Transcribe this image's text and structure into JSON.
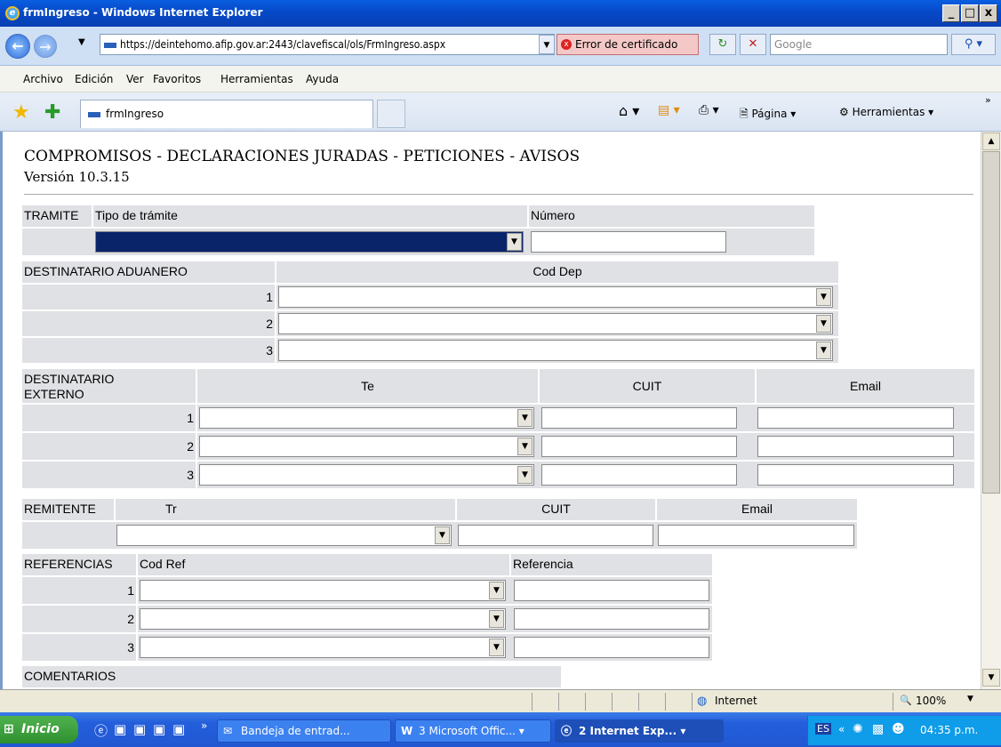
{
  "window": {
    "title": "frmIngreso - Windows Internet Explorer",
    "min": "_",
    "max": "□",
    "close": "x"
  },
  "address": {
    "url": "https://deintehomo.afip.gov.ar:2443/clavefiscal/ols/FrmIngreso.aspx",
    "cert_error": "Error de certificado",
    "search_placeholder": "Google"
  },
  "menu": [
    "Archivo",
    "Edición",
    "Ver",
    "Favoritos",
    "Herramientas",
    "Ayuda"
  ],
  "tab": {
    "label": "frmIngreso"
  },
  "commands": {
    "page": "Página",
    "tools": "Herramientas"
  },
  "page": {
    "title": "COMPROMISOS - DECLARACIONES JURADAS - PETICIONES - AVISOS",
    "version": "Versión 10.3.15",
    "tramite": {
      "section": "TRAMITE",
      "col_tipo": "Tipo de trámite",
      "col_numero": "Número"
    },
    "dest_aduanero": {
      "section": "DESTINATARIO ADUANERO",
      "col_coddep": "Cod Dep",
      "rows": [
        "1",
        "2",
        "3"
      ]
    },
    "dest_externo": {
      "section_l1": "DESTINATARIO",
      "section_l2": "EXTERNO",
      "col_te": "Te",
      "col_cuit": "CUIT",
      "col_email": "Email",
      "rows": [
        "1",
        "2",
        "3"
      ]
    },
    "remitente": {
      "section": "REMITENTE",
      "col_tr": "Tr",
      "col_cuit": "CUIT",
      "col_email": "Email"
    },
    "referencias": {
      "section": "REFERENCIAS",
      "col_codref": "Cod Ref",
      "col_ref": "Referencia",
      "rows": [
        "1",
        "2",
        "3"
      ]
    },
    "comentarios": {
      "section": "COMENTARIOS"
    }
  },
  "status": {
    "zone": "Internet",
    "zoom": "100%"
  },
  "taskbar": {
    "start": "Inicio",
    "buttons": [
      "Bandeja de entrad...",
      "3 Microsoft Offic...",
      "2 Internet Exp..."
    ],
    "lang": "ES",
    "clock": "04:35 p.m."
  }
}
